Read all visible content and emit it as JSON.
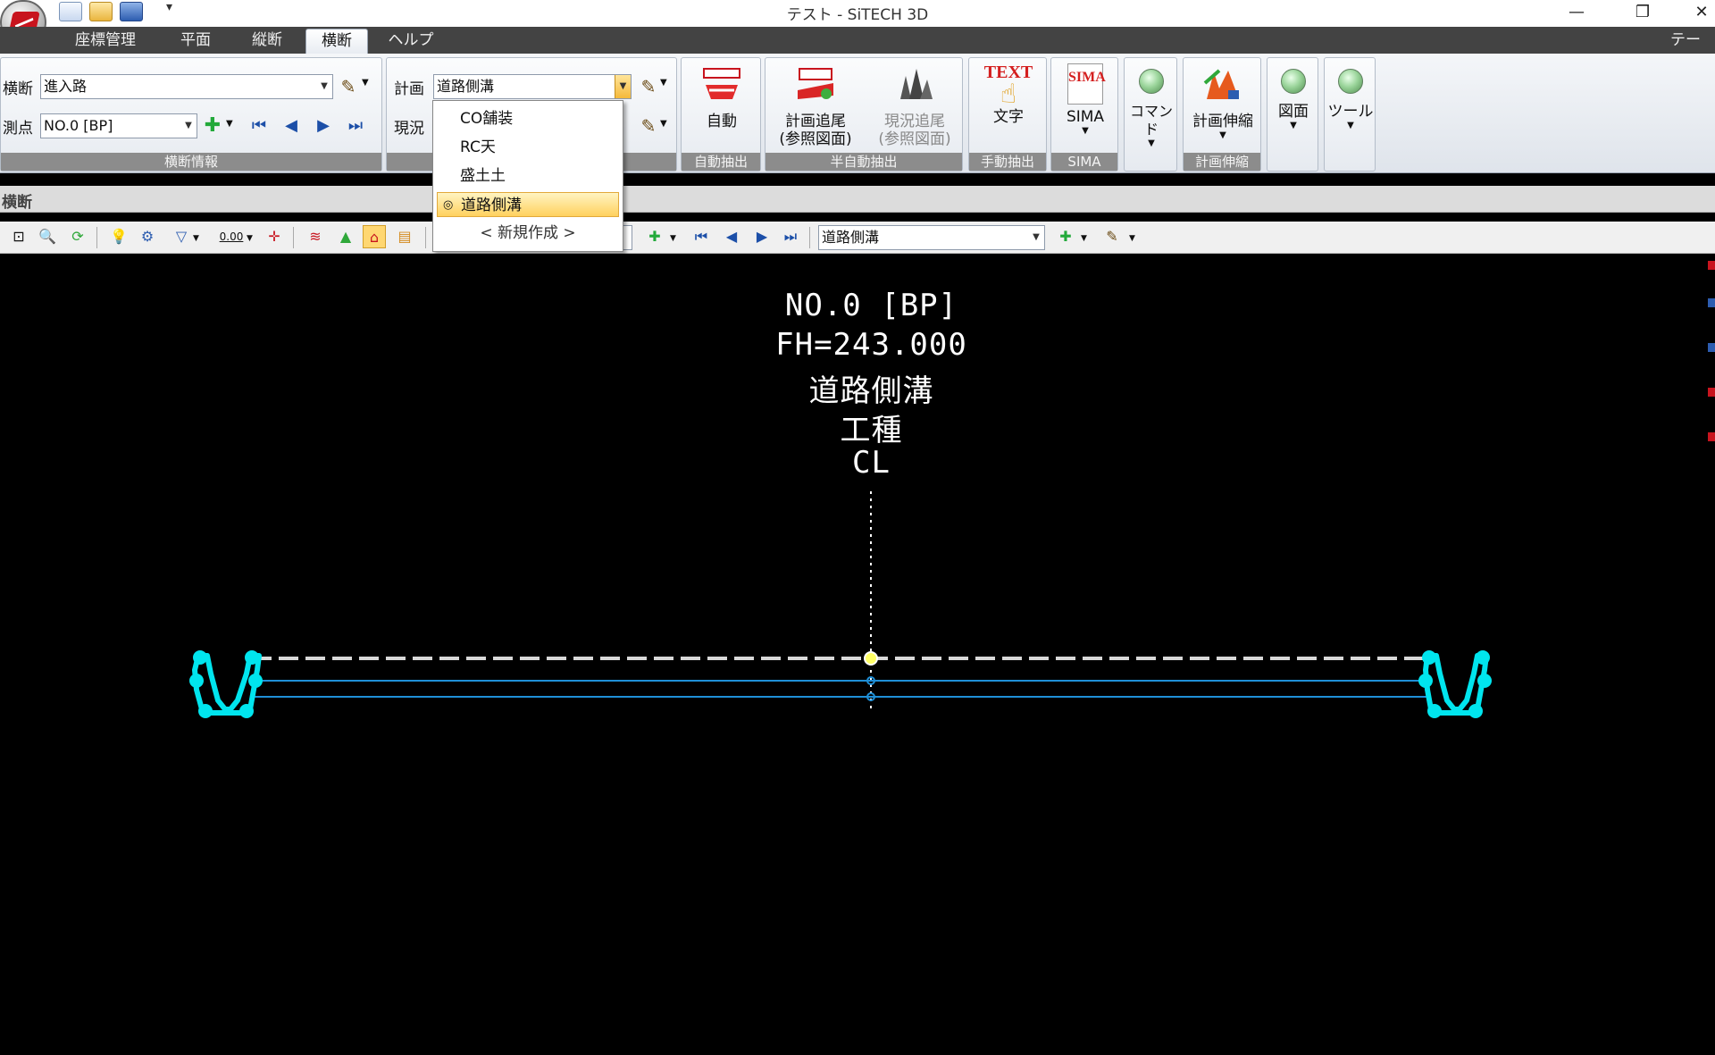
{
  "window": {
    "title": "テスト - SiTECH 3D",
    "controls": {
      "minimize": "—",
      "restore": "❐",
      "close": "✕"
    }
  },
  "tabs": [
    {
      "label": "座標管理"
    },
    {
      "label": "平面"
    },
    {
      "label": "縦断"
    },
    {
      "label": "横断",
      "active": true
    },
    {
      "label": "ヘルプ"
    }
  ],
  "theme_label": "テーマ",
  "ribbon": {
    "cross_info": {
      "group_label": "横断情報",
      "cross_label": "横断",
      "cross_value": "進入路",
      "station_label": "測点",
      "station_value": "NO.0 [BP]"
    },
    "plan": {
      "plan_label": "計画",
      "plan_value": "道路側溝",
      "current_label": "現況"
    },
    "auto": {
      "group_label": "自動抽出",
      "button": "自動"
    },
    "semi_auto": {
      "group_label": "半自動抽出",
      "plan_trace_1": "計画追尾",
      "plan_trace_2": "(参照図面)",
      "current_trace_1": "現況追尾",
      "current_trace_2": "(参照図面)"
    },
    "manual": {
      "group_label": "手動抽出",
      "icon_text": "TEXT",
      "button": "文字"
    },
    "sima": {
      "group_label": "SIMA",
      "icon_text": "SIMA",
      "button": "SIMA"
    },
    "command": {
      "button": "コマンド"
    },
    "stretch": {
      "group_label": "計画伸縮",
      "button": "計画伸縮"
    },
    "drawing": {
      "button": "図面"
    },
    "tool": {
      "button": "ツール"
    }
  },
  "section": {
    "title": "横断"
  },
  "toolbar": {
    "decimal_label": "0.00",
    "layer_combo_value": "道路側溝"
  },
  "dropdown": {
    "items": [
      {
        "label": "CO舗装"
      },
      {
        "label": "RC天"
      },
      {
        "label": "盛土土"
      },
      {
        "label": "道路側溝",
        "selected": true,
        "marker": "◎"
      },
      {
        "label": "< 新規作成 >"
      }
    ]
  },
  "canvas": {
    "station": "NO.0 [BP]",
    "fh": "FH=243.000",
    "layer": "道路側溝",
    "work_type": "工種",
    "center_label": "CL",
    "colors": {
      "background": "#000000",
      "ditch": "#00e5ee",
      "line": "#1f8fd6",
      "road": "#d8d8d8",
      "point": "#ffff66"
    }
  }
}
